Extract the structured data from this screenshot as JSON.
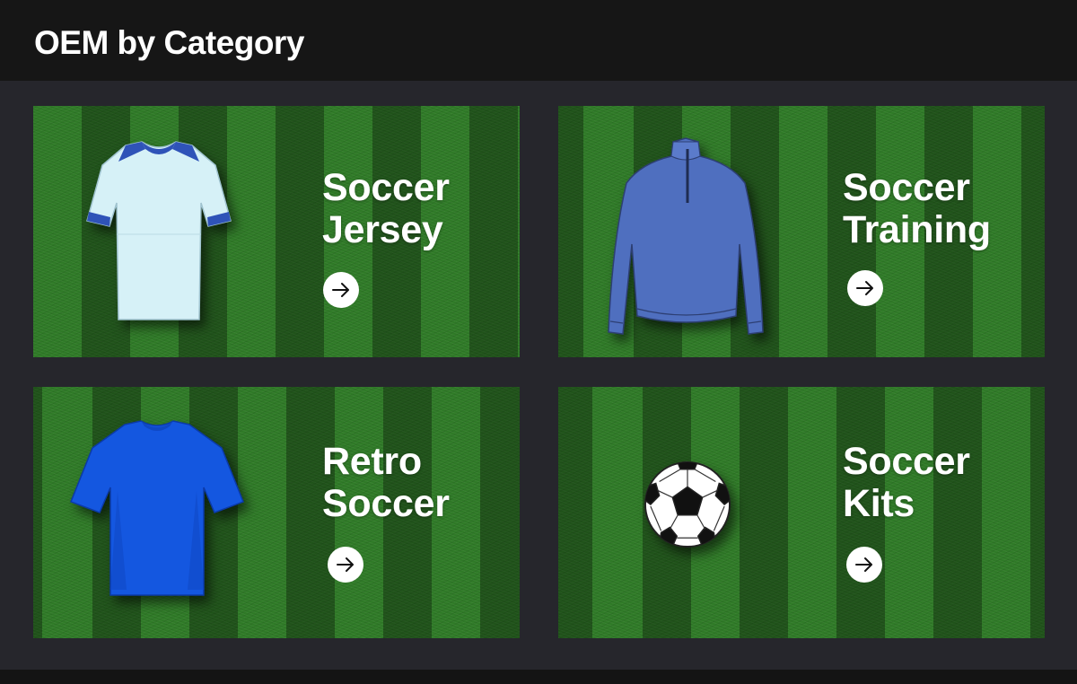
{
  "header": {
    "title": "OEM by Category"
  },
  "colors": {
    "header_bg": "#161616",
    "panel_bg": "#26262c",
    "grass": "#2f7a27",
    "jersey_light": "#d6f1f7",
    "jersey_trim": "#2f53b8",
    "training_top": "#4f6fbf",
    "retro_jersey": "#1457e0"
  },
  "categories": [
    {
      "title_line1": "Soccer",
      "title_line2": "Jersey",
      "image": "light-blue-jersey",
      "action_icon": "arrow-right-icon"
    },
    {
      "title_line1": "Soccer",
      "title_line2": "Training",
      "image": "blue-training-top",
      "action_icon": "arrow-right-icon"
    },
    {
      "title_line1": "Retro",
      "title_line2": "Soccer",
      "image": "blue-jersey",
      "action_icon": "arrow-right-icon"
    },
    {
      "title_line1": "Soccer",
      "title_line2": "Kits",
      "image": "soccer-ball",
      "action_icon": "arrow-right-icon"
    }
  ]
}
